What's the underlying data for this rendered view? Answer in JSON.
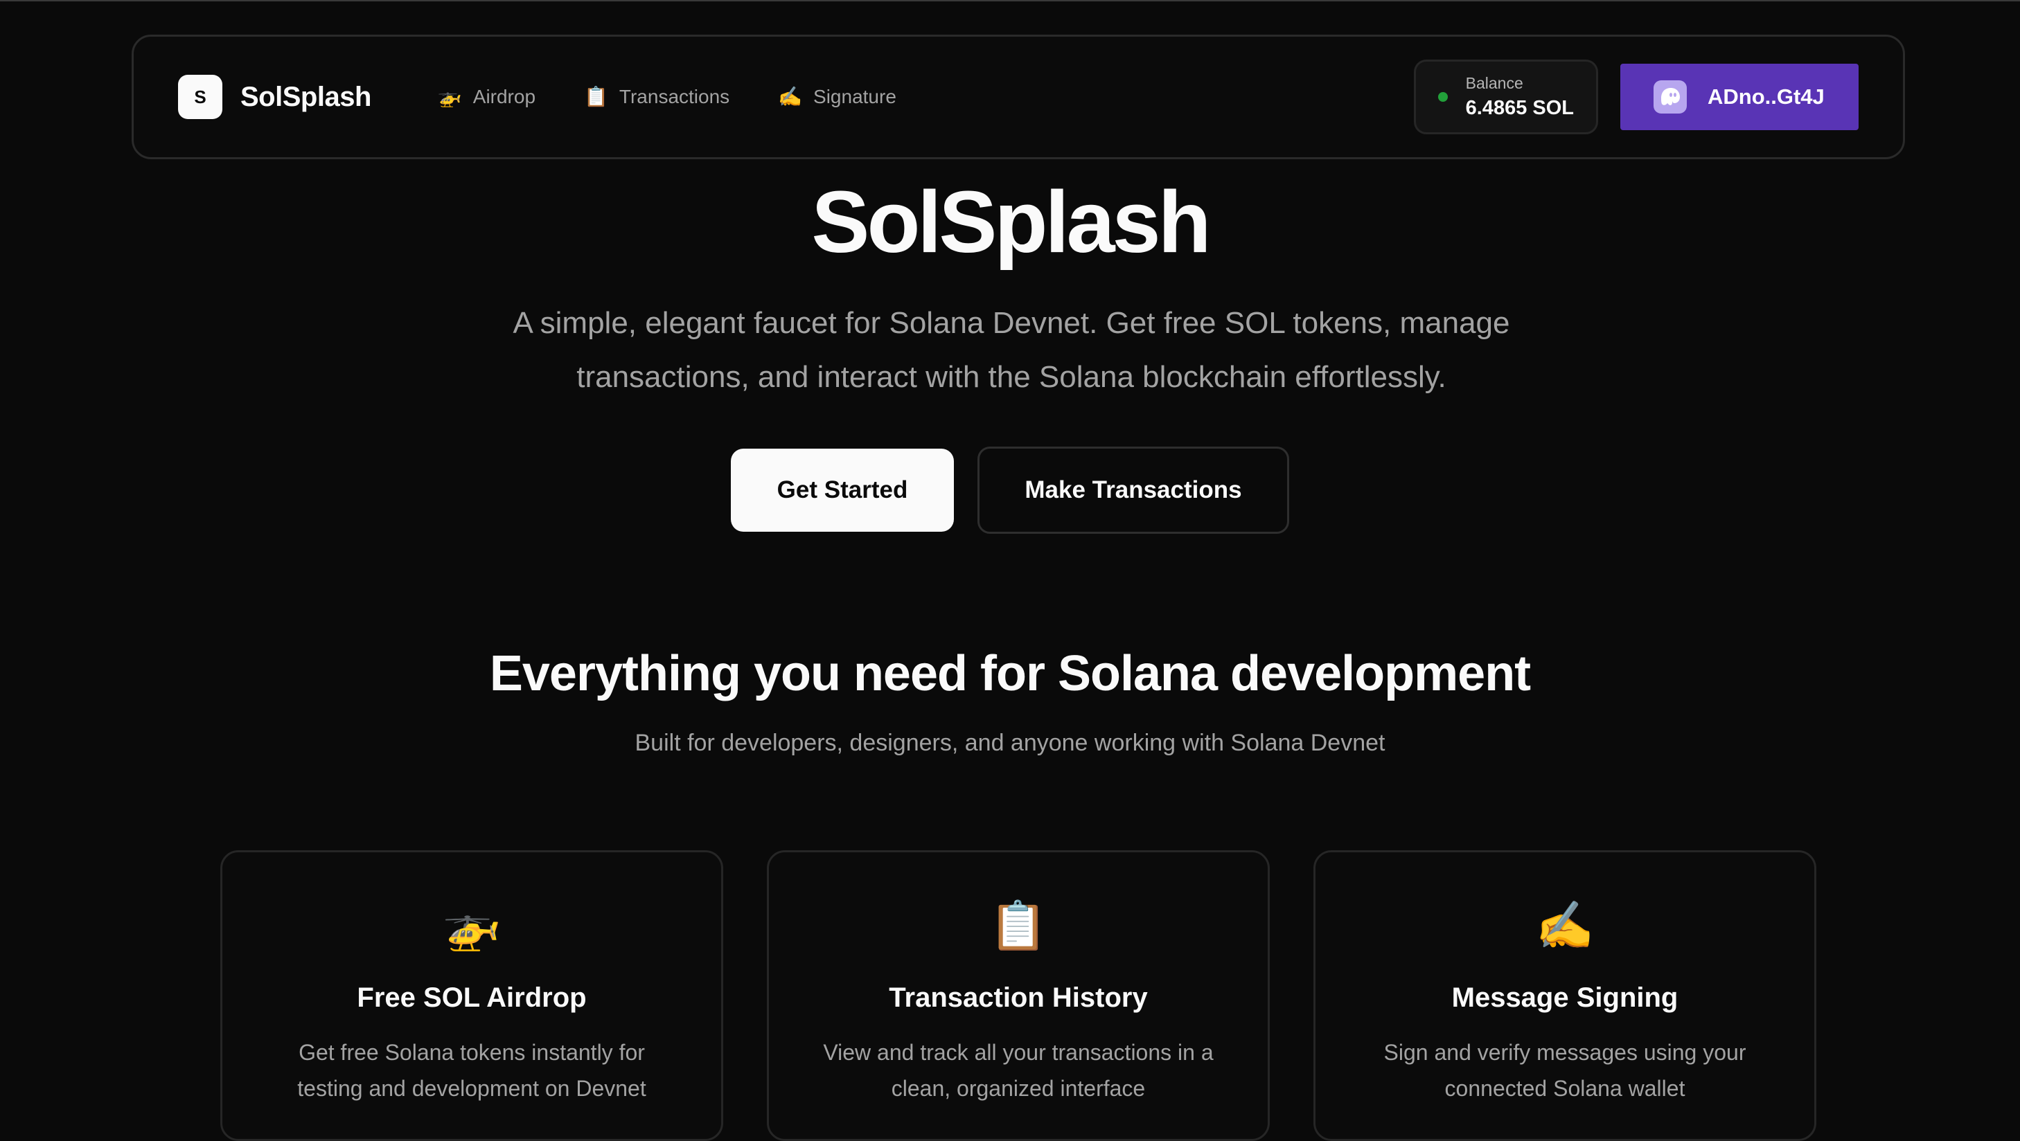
{
  "nav": {
    "brand_mark": "S",
    "brand_name": "SolSplash",
    "links": [
      {
        "icon": "🚁",
        "icon_name": "helicopter-icon",
        "label": "Airdrop"
      },
      {
        "icon": "📋",
        "icon_name": "clipboard-icon",
        "label": "Transactions"
      },
      {
        "icon": "✍️",
        "icon_name": "writing-hand-icon",
        "label": "Signature"
      }
    ],
    "balance": {
      "label": "Balance",
      "value": "6.4865 SOL",
      "status_color": "#22a03a"
    },
    "wallet": {
      "address": "ADno..Gt4J",
      "icon_name": "phantom-ghost-icon",
      "color": "#5934b5"
    }
  },
  "hero": {
    "title": "SolSplash",
    "subtitle": "A simple, elegant faucet for Solana Devnet. Get free SOL tokens, manage transactions, and interact with the Solana blockchain effortlessly.",
    "primary_button": "Get Started",
    "secondary_button": "Make Transactions"
  },
  "features": {
    "title": "Everything you need for Solana development",
    "subtitle": "Built for developers, designers, and anyone working with Solana Devnet",
    "cards": [
      {
        "icon": "🚁",
        "icon_name": "helicopter-icon",
        "title": "Free SOL Airdrop",
        "description": "Get free Solana tokens instantly for testing and development on Devnet"
      },
      {
        "icon": "📋",
        "icon_name": "clipboard-icon",
        "title": "Transaction History",
        "description": "View and track all your transactions in a clean, organized interface"
      },
      {
        "icon": "✍️",
        "icon_name": "writing-hand-icon",
        "title": "Message Signing",
        "description": "Sign and verify messages using your connected Solana wallet"
      }
    ]
  }
}
